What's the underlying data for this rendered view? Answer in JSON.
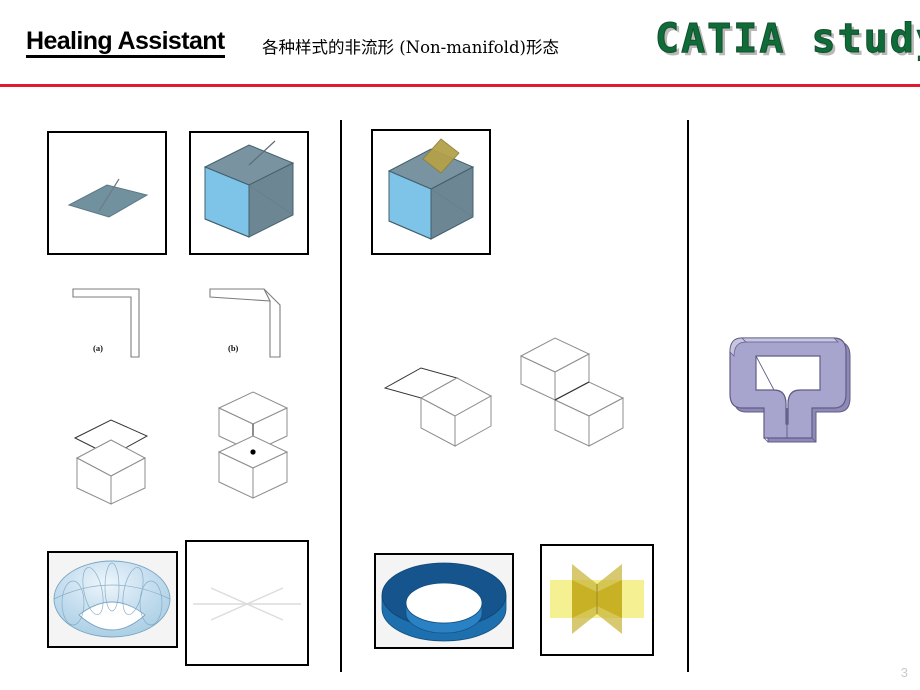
{
  "slide": {
    "page_number": "3",
    "accent_rule_color": "#e01b30",
    "background_color": "#ffffff"
  },
  "header": {
    "title": "Healing Assistant",
    "subtitle": "各种样式的非流形 (Non-manifold)形态",
    "brand": "CATIA study",
    "brand_color": "#0f6b38",
    "brand_shadow_color": "#b9b9b9"
  },
  "columns": [
    {
      "name": "column-left"
    },
    {
      "name": "column-middle"
    },
    {
      "name": "column-right"
    }
  ],
  "figures": [
    {
      "id": "plane-with-dangling-edge",
      "label": "gray plane with dangling edge",
      "framed": true,
      "colors": {
        "face": "#72919f",
        "edge": "#5a7784"
      }
    },
    {
      "id": "cube-with-dangling-edge",
      "label": "blue cube with dangling edge",
      "framed": true,
      "colors": {
        "front": "#7ec4e8",
        "top": "#7a93a0",
        "side": "#6c8694",
        "edge": "#44606d"
      }
    },
    {
      "id": "cube-with-intersecting-plane",
      "label": "blue cube with yellow plane piercing the top face",
      "framed": true,
      "colors": {
        "front": "#7ec4e8",
        "top": "#7a93a0",
        "side": "#6c8694",
        "plane": "#b3a14a"
      }
    },
    {
      "id": "l-profile-a",
      "label": "(a)",
      "framed": false,
      "colors": {
        "stroke": "#777777"
      }
    },
    {
      "id": "l-profile-b",
      "label": "(b)",
      "framed": false,
      "colors": {
        "stroke": "#777777"
      }
    },
    {
      "id": "plane-above-cube",
      "label": "wireframe cube with a plane touching its top vertex",
      "framed": false,
      "colors": {
        "stroke": "#8d8d8d",
        "accent": "#333333"
      }
    },
    {
      "id": "two-cubes-vertex-contact",
      "label": "two wireframe cubes meeting at a single vertex",
      "framed": false,
      "colors": {
        "stroke": "#8d8d8d",
        "vertex": "#000000"
      }
    },
    {
      "id": "cube-with-flange-plane",
      "label": "wireframe cube with a plane attached along a top edge",
      "framed": false,
      "colors": {
        "stroke": "#8d8d8d",
        "accent": "#333333"
      }
    },
    {
      "id": "two-cubes-edge-contact",
      "label": "two wireframe cubes meeting along a single edge",
      "framed": false,
      "colors": {
        "stroke": "#8d8d8d",
        "accent": "#333333"
      }
    },
    {
      "id": "pinched-torus",
      "label": "light blue pinched torus surface",
      "framed": true,
      "colors": {
        "fill": "#b8d9ec",
        "edge": "#6f9cb8",
        "bg": "#f4f4f4"
      }
    },
    {
      "id": "crossing-edges",
      "label": "three edges crossing at one point",
      "framed": true,
      "colors": {
        "stroke": "#dcdcdc"
      }
    },
    {
      "id": "washer-solid",
      "label": "dark blue washer / annulus solid",
      "framed": true,
      "colors": {
        "top": "#15548c",
        "inner": "#1c6aab",
        "outer": "#1d6fae",
        "bg": "#f4f4f4"
      }
    },
    {
      "id": "intersecting-yellow-planes",
      "label": "two translucent yellow planes intersecting",
      "framed": true,
      "colors": {
        "plane_a": "#f5f08a",
        "plane_b": "#c9b43a",
        "overlap": "#c9ae1f"
      }
    },
    {
      "id": "purple-extruded-frame",
      "label": "lavender extruded non-manifold frame with stem",
      "framed": false,
      "colors": {
        "face": "#a7a4ce",
        "top": "#bcbadc",
        "edge": "#5f5d86",
        "shade": "#8d8ab8"
      }
    }
  ]
}
